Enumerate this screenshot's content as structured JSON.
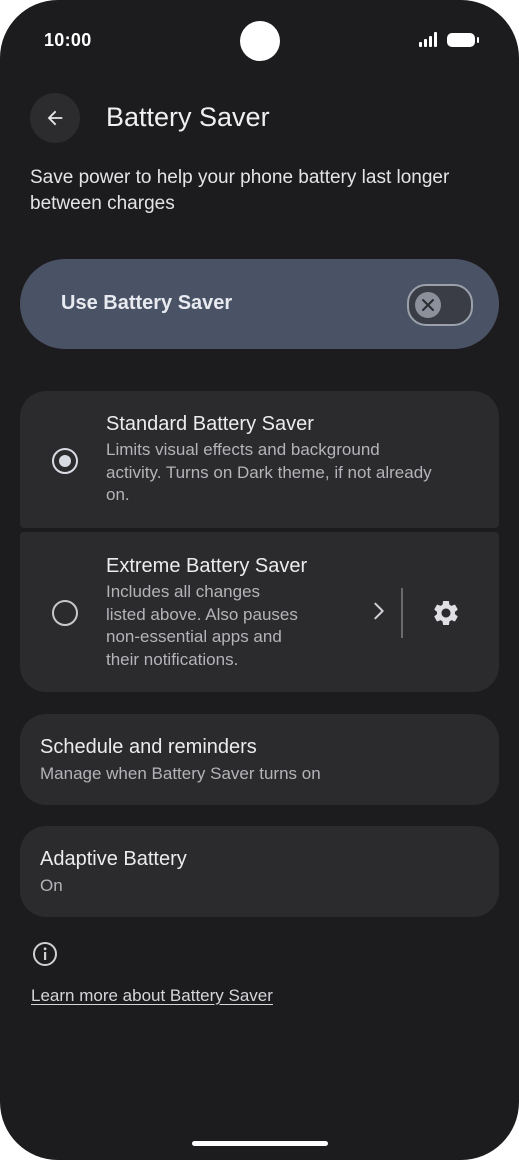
{
  "status_bar": {
    "time": "10:00",
    "signal_icon": "signal-icon",
    "battery_icon": "battery-icon"
  },
  "header": {
    "back_icon": "arrow-back-icon",
    "title": "Battery Saver"
  },
  "description": "Save power to help your phone battery last longer between charges",
  "main_toggle": {
    "label": "Use Battery Saver",
    "state": "off"
  },
  "options": [
    {
      "title": "Standard Battery Saver",
      "description_lines": [
        "Limits visual effects and background",
        "activity. Turns on Dark theme, if not already",
        "on."
      ],
      "selected": true
    },
    {
      "title": "Extreme Battery Saver",
      "description_lines": [
        "Includes all changes",
        "listed above. Also pauses",
        "non-essential apps and",
        "their notifications."
      ],
      "selected": false,
      "settings_icon": "gear-icon"
    }
  ],
  "schedule": {
    "title": "Schedule and reminders",
    "subtitle": "Manage when Battery Saver turns on"
  },
  "adaptive_battery": {
    "title": "Adaptive Battery",
    "subtitle": "On"
  },
  "footer": {
    "info_icon": "info-icon",
    "learn_more": "Learn more about Battery Saver"
  },
  "colors": {
    "background": "#1c1c1e",
    "card": "#2b2b2e",
    "toggle_card": "#4a5366",
    "text_primary": "#ececee",
    "text_secondary": "#b4b4b8"
  }
}
